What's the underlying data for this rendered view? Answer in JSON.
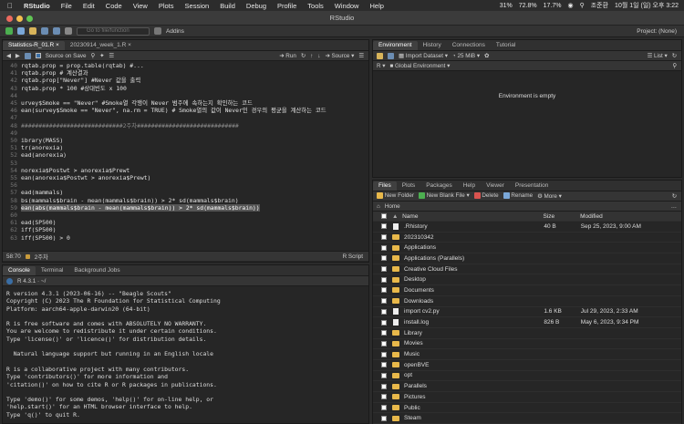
{
  "menubar": {
    "items": [
      "RStudio",
      "File",
      "Edit",
      "Code",
      "View",
      "Plots",
      "Session",
      "Build",
      "Debug",
      "Profile",
      "Tools",
      "Window",
      "Help"
    ],
    "status": [
      "31%",
      "72.8%",
      "17.7%",
      "조준환",
      "10월 1일 (일) 오후 3:22"
    ]
  },
  "window": {
    "title": "RStudio"
  },
  "toolbar": {
    "goto_placeholder": "Go to file/function",
    "addins": "Addins",
    "project": "Project: (None)"
  },
  "editor": {
    "tabs": [
      "Statistics-R_01.R",
      "20230914_week_1.R"
    ],
    "source_on_save": "Source on Save",
    "run": "Run",
    "source": "Source",
    "status_pos": "58:70",
    "status_scope": "2주차",
    "status_type": "R Script",
    "lines": [
      {
        "n": "40",
        "t": "rqtab.prop = prop.table(rqtab) #...",
        "c": "kw"
      },
      {
        "n": "41",
        "t": "rqtab.prop # 계산결과",
        "c": "kw"
      },
      {
        "n": "42",
        "t": "rqtab.prop[\"Never\"] #Never 값을 출력",
        "c": "kw"
      },
      {
        "n": "43",
        "t": "rqtab.prop * 100 #상대빈도 x 100",
        "c": "kw"
      },
      {
        "n": "44",
        "t": "",
        "c": "kw"
      },
      {
        "n": "45",
        "t": "urvey$Smoke == \"Never\" #Smoke열 각행이 Never 범주에 속하는지 확인하는 코드",
        "c": "kw"
      },
      {
        "n": "46",
        "t": "ean(survey$Smoke == \"Never\", na.rm = TRUE) # Smoke열의 값이 Never인 경우의 평균을 계산하는 코드",
        "c": "kw"
      },
      {
        "n": "47",
        "t": "",
        "c": "kw"
      },
      {
        "n": "48",
        "t": "#############################2주차#############################",
        "c": "cm"
      },
      {
        "n": "49",
        "t": "",
        "c": "kw"
      },
      {
        "n": "50",
        "t": "ibrary(MASS)",
        "c": "kw"
      },
      {
        "n": "51",
        "t": "tr(anorexia)",
        "c": "kw"
      },
      {
        "n": "52",
        "t": "ead(anorexia)",
        "c": "kw"
      },
      {
        "n": "53",
        "t": "",
        "c": "kw"
      },
      {
        "n": "54",
        "t": "norexia$Postwt > anorexia$Prewt",
        "c": "kw"
      },
      {
        "n": "55",
        "t": "ean(anorexia$Postwt > anorexia$Prewt)",
        "c": "kw"
      },
      {
        "n": "56",
        "t": "",
        "c": "kw"
      },
      {
        "n": "57",
        "t": "ead(mammals)",
        "c": "kw"
      },
      {
        "n": "58",
        "t": "bs(mammals$brain - mean(mammals$brain)) > 2* sd(mammals$brain)",
        "c": "kw"
      },
      {
        "n": "59",
        "t": "ean(abs(mammals$brain - mean(mammals$brain)) > 2* sd(mammals$brain))",
        "c": "sel"
      },
      {
        "n": "60",
        "t": "",
        "c": "kw"
      },
      {
        "n": "61",
        "t": "ead(SP500)",
        "c": "kw"
      },
      {
        "n": "62",
        "t": "iff(SP500)",
        "c": "kw"
      },
      {
        "n": "63",
        "t": "iff(SP500) > 0",
        "c": "kw"
      }
    ]
  },
  "console": {
    "tabs": [
      "Console",
      "Terminal",
      "Background Jobs"
    ],
    "r_version": "R 4.3.1 · ~/",
    "lines": [
      "R version 4.3.1 (2023-06-16) -- \"Beagle Scouts\"",
      "Copyright (C) 2023 The R Foundation for Statistical Computing",
      "Platform: aarch64-apple-darwin20 (64-bit)",
      "",
      "R is free software and comes with ABSOLUTELY NO WARRANTY.",
      "You are welcome to redistribute it under certain conditions.",
      "Type 'license()' or 'licence()' for distribution details.",
      "",
      "  Natural language support but running in an English locale",
      "",
      "R is a collaborative project with many contributors.",
      "Type 'contributors()' for more information and",
      "'citation()' on how to cite R or R packages in publications.",
      "",
      "Type 'demo()' for some demos, 'help()' for on-line help, or",
      "'help.start()' for an HTML browser interface to help.",
      "Type 'q()' to quit R."
    ]
  },
  "environment": {
    "tabs": [
      "Environment",
      "History",
      "Connections",
      "Tutorial"
    ],
    "import_dataset": "Import Dataset",
    "memory": "25 MiB",
    "list": "List",
    "r_label": "R",
    "global_env": "Global Environment",
    "empty_message": "Environment is empty"
  },
  "files": {
    "tabs": [
      "Files",
      "Plots",
      "Packages",
      "Help",
      "Viewer",
      "Presentation"
    ],
    "new_folder": "New Folder",
    "new_blank_file": "New Blank File",
    "delete": "Delete",
    "rename": "Rename",
    "more": "More",
    "home": "Home",
    "columns": {
      "name": "Name",
      "size": "Size",
      "modified": "Modified"
    },
    "rows": [
      {
        "name": ".Rhistory",
        "size": "40 B",
        "modified": "Sep 25, 2023, 9:00 AM",
        "type": "file"
      },
      {
        "name": "202310342",
        "size": "",
        "modified": "",
        "type": "folder"
      },
      {
        "name": "Applications",
        "size": "",
        "modified": "",
        "type": "folder"
      },
      {
        "name": "Applications (Parallels)",
        "size": "",
        "modified": "",
        "type": "folder"
      },
      {
        "name": "Creative Cloud Files",
        "size": "",
        "modified": "",
        "type": "folder"
      },
      {
        "name": "Desktop",
        "size": "",
        "modified": "",
        "type": "folder"
      },
      {
        "name": "Documents",
        "size": "",
        "modified": "",
        "type": "folder"
      },
      {
        "name": "Downloads",
        "size": "",
        "modified": "",
        "type": "folder"
      },
      {
        "name": "import cv2.py",
        "size": "1.6 KB",
        "modified": "Jul 29, 2023, 2:33 AM",
        "type": "file"
      },
      {
        "name": "install.log",
        "size": "826 B",
        "modified": "May 6, 2023, 9:34 PM",
        "type": "file"
      },
      {
        "name": "Library",
        "size": "",
        "modified": "",
        "type": "folder"
      },
      {
        "name": "Movies",
        "size": "",
        "modified": "",
        "type": "folder"
      },
      {
        "name": "Music",
        "size": "",
        "modified": "",
        "type": "folder"
      },
      {
        "name": "openBVE",
        "size": "",
        "modified": "",
        "type": "folder"
      },
      {
        "name": "opt",
        "size": "",
        "modified": "",
        "type": "folder"
      },
      {
        "name": "Parallels",
        "size": "",
        "modified": "",
        "type": "folder"
      },
      {
        "name": "Pictures",
        "size": "",
        "modified": "",
        "type": "folder"
      },
      {
        "name": "Public",
        "size": "",
        "modified": "",
        "type": "folder"
      },
      {
        "name": "Steam",
        "size": "",
        "modified": "",
        "type": "folder"
      }
    ]
  }
}
